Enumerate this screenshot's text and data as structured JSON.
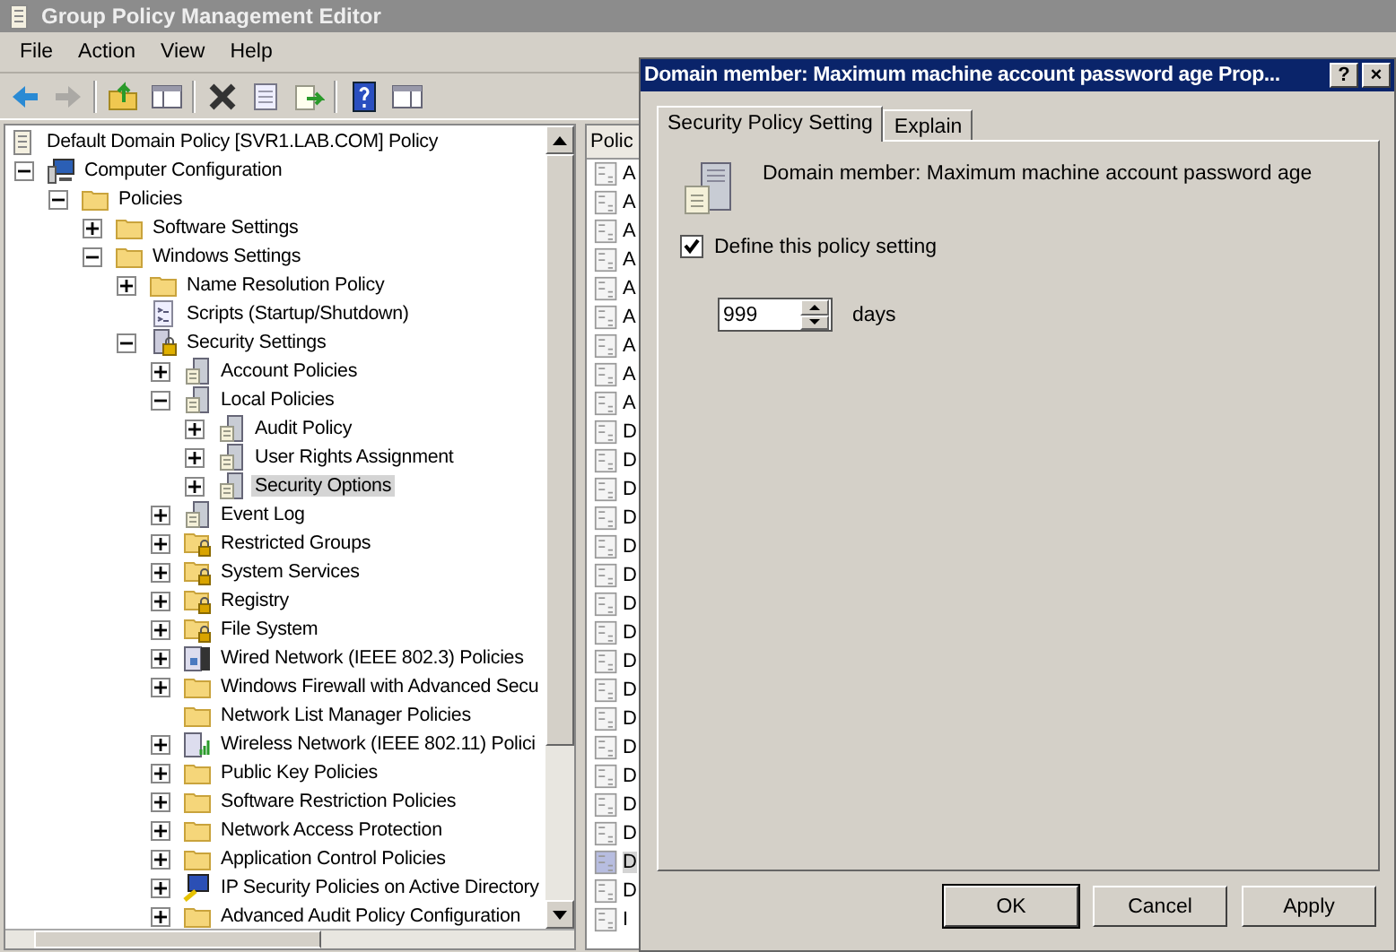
{
  "window": {
    "title": "Group Policy Management Editor"
  },
  "menu": [
    "File",
    "Action",
    "View",
    "Help"
  ],
  "toolbar": [
    {
      "kind": "back",
      "disabled": false
    },
    {
      "kind": "forward",
      "disabled": true
    },
    {
      "kind": "sep"
    },
    {
      "kind": "up",
      "disabled": false
    },
    {
      "kind": "panes",
      "disabled": false
    },
    {
      "kind": "sep"
    },
    {
      "kind": "delete",
      "disabled": false
    },
    {
      "kind": "properties",
      "disabled": false
    },
    {
      "kind": "export",
      "disabled": false
    },
    {
      "kind": "sep"
    },
    {
      "kind": "help",
      "disabled": false
    },
    {
      "kind": "actionpane",
      "disabled": false
    }
  ],
  "tree": {
    "root": {
      "label": "Default Domain Policy [SVR1.LAB.COM] Policy",
      "kind": "doc"
    },
    "items": [
      {
        "label": "Computer Configuration",
        "kind": "computer",
        "expanded": true,
        "selected": false,
        "children": [
          {
            "label": "Policies",
            "kind": "folder",
            "expanded": true,
            "selected": false,
            "children": [
              {
                "label": "Software Settings",
                "kind": "folder",
                "expanded": false,
                "selected": false
              },
              {
                "label": "Windows Settings",
                "kind": "folder",
                "expanded": true,
                "selected": false,
                "children": [
                  {
                    "label": "Name Resolution Policy",
                    "kind": "folder",
                    "expanded": false,
                    "selected": false
                  },
                  {
                    "label": "Scripts (Startup/Shutdown)",
                    "kind": "script",
                    "selected": false
                  },
                  {
                    "label": "Security Settings",
                    "kind": "secure",
                    "expanded": true,
                    "selected": false,
                    "children": [
                      {
                        "label": "Account Policies",
                        "kind": "server",
                        "expanded": false,
                        "selected": false
                      },
                      {
                        "label": "Local Policies",
                        "kind": "server",
                        "expanded": true,
                        "selected": false,
                        "children": [
                          {
                            "label": "Audit Policy",
                            "kind": "server",
                            "expanded": false,
                            "selected": false
                          },
                          {
                            "label": "User Rights Assignment",
                            "kind": "server",
                            "expanded": false,
                            "selected": false
                          },
                          {
                            "label": "Security Options",
                            "kind": "server",
                            "expanded": false,
                            "selected": true
                          }
                        ]
                      },
                      {
                        "label": "Event Log",
                        "kind": "server",
                        "expanded": false,
                        "selected": false
                      },
                      {
                        "label": "Restricted Groups",
                        "kind": "lockfolder",
                        "expanded": false,
                        "selected": false
                      },
                      {
                        "label": "System Services",
                        "kind": "lockfolder",
                        "expanded": false,
                        "selected": false
                      },
                      {
                        "label": "Registry",
                        "kind": "lockfolder",
                        "expanded": false,
                        "selected": false
                      },
                      {
                        "label": "File System",
                        "kind": "lockfolder",
                        "expanded": false,
                        "selected": false
                      },
                      {
                        "label": "Wired Network (IEEE 802.3) Policies",
                        "kind": "network",
                        "expanded": false,
                        "selected": false
                      },
                      {
                        "label": "Windows Firewall with Advanced Secu",
                        "kind": "folder",
                        "expanded": false,
                        "selected": false
                      },
                      {
                        "label": "Network List Manager Policies",
                        "kind": "folder",
                        "selected": false
                      },
                      {
                        "label": "Wireless Network (IEEE 802.11) Polici",
                        "kind": "wireless",
                        "expanded": false,
                        "selected": false
                      },
                      {
                        "label": "Public Key Policies",
                        "kind": "folder",
                        "expanded": false,
                        "selected": false
                      },
                      {
                        "label": "Software Restriction Policies",
                        "kind": "folder",
                        "expanded": false,
                        "selected": false
                      },
                      {
                        "label": "Network Access Protection",
                        "kind": "folder",
                        "expanded": false,
                        "selected": false
                      },
                      {
                        "label": "Application Control Policies",
                        "kind": "folder",
                        "expanded": false,
                        "selected": false
                      },
                      {
                        "label": "IP Security Policies on Active Directory",
                        "kind": "ipsec",
                        "expanded": false,
                        "selected": false
                      },
                      {
                        "label": "Advanced Audit Policy Configuration",
                        "kind": "folder",
                        "expanded": false,
                        "selected": false
                      }
                    ]
                  }
                ]
              }
            ]
          }
        ]
      }
    ]
  },
  "list": {
    "column_1": "Polic",
    "rows": [
      {
        "text": "A",
        "selected": false
      },
      {
        "text": "A",
        "selected": false
      },
      {
        "text": "A",
        "selected": false
      },
      {
        "text": "A",
        "selected": false
      },
      {
        "text": "A",
        "selected": false
      },
      {
        "text": "A",
        "selected": false
      },
      {
        "text": "A",
        "selected": false
      },
      {
        "text": "A",
        "selected": false
      },
      {
        "text": "A",
        "selected": false
      },
      {
        "text": "D",
        "selected": false
      },
      {
        "text": "D",
        "selected": false
      },
      {
        "text": "D",
        "selected": false
      },
      {
        "text": "D",
        "selected": false
      },
      {
        "text": "D",
        "selected": false
      },
      {
        "text": "D",
        "selected": false
      },
      {
        "text": "D",
        "selected": false
      },
      {
        "text": "D",
        "selected": false
      },
      {
        "text": "D",
        "selected": false
      },
      {
        "text": "D",
        "selected": false
      },
      {
        "text": "D",
        "selected": false
      },
      {
        "text": "D",
        "selected": false
      },
      {
        "text": "D",
        "selected": false
      },
      {
        "text": "D",
        "selected": false
      },
      {
        "text": "D",
        "selected": false
      },
      {
        "text": "D",
        "selected": true
      },
      {
        "text": "D",
        "selected": false
      },
      {
        "text": "I",
        "selected": false
      }
    ]
  },
  "dialog": {
    "title": "Domain member: Maximum machine account password age Prop...",
    "title_buttons": [
      "?",
      "×"
    ],
    "tabs": [
      {
        "label": "Security Policy Setting",
        "selected": true
      },
      {
        "label": "Explain",
        "selected": false
      }
    ],
    "policy_name": "Domain member: Maximum machine account password age",
    "define_setting": {
      "label": "Define this policy setting",
      "checked": true
    },
    "value": "999",
    "unit": "days",
    "buttons": [
      {
        "label": "OK",
        "default": true
      },
      {
        "label": "Cancel",
        "default": false
      },
      {
        "label": "Apply",
        "default": false
      }
    ]
  }
}
